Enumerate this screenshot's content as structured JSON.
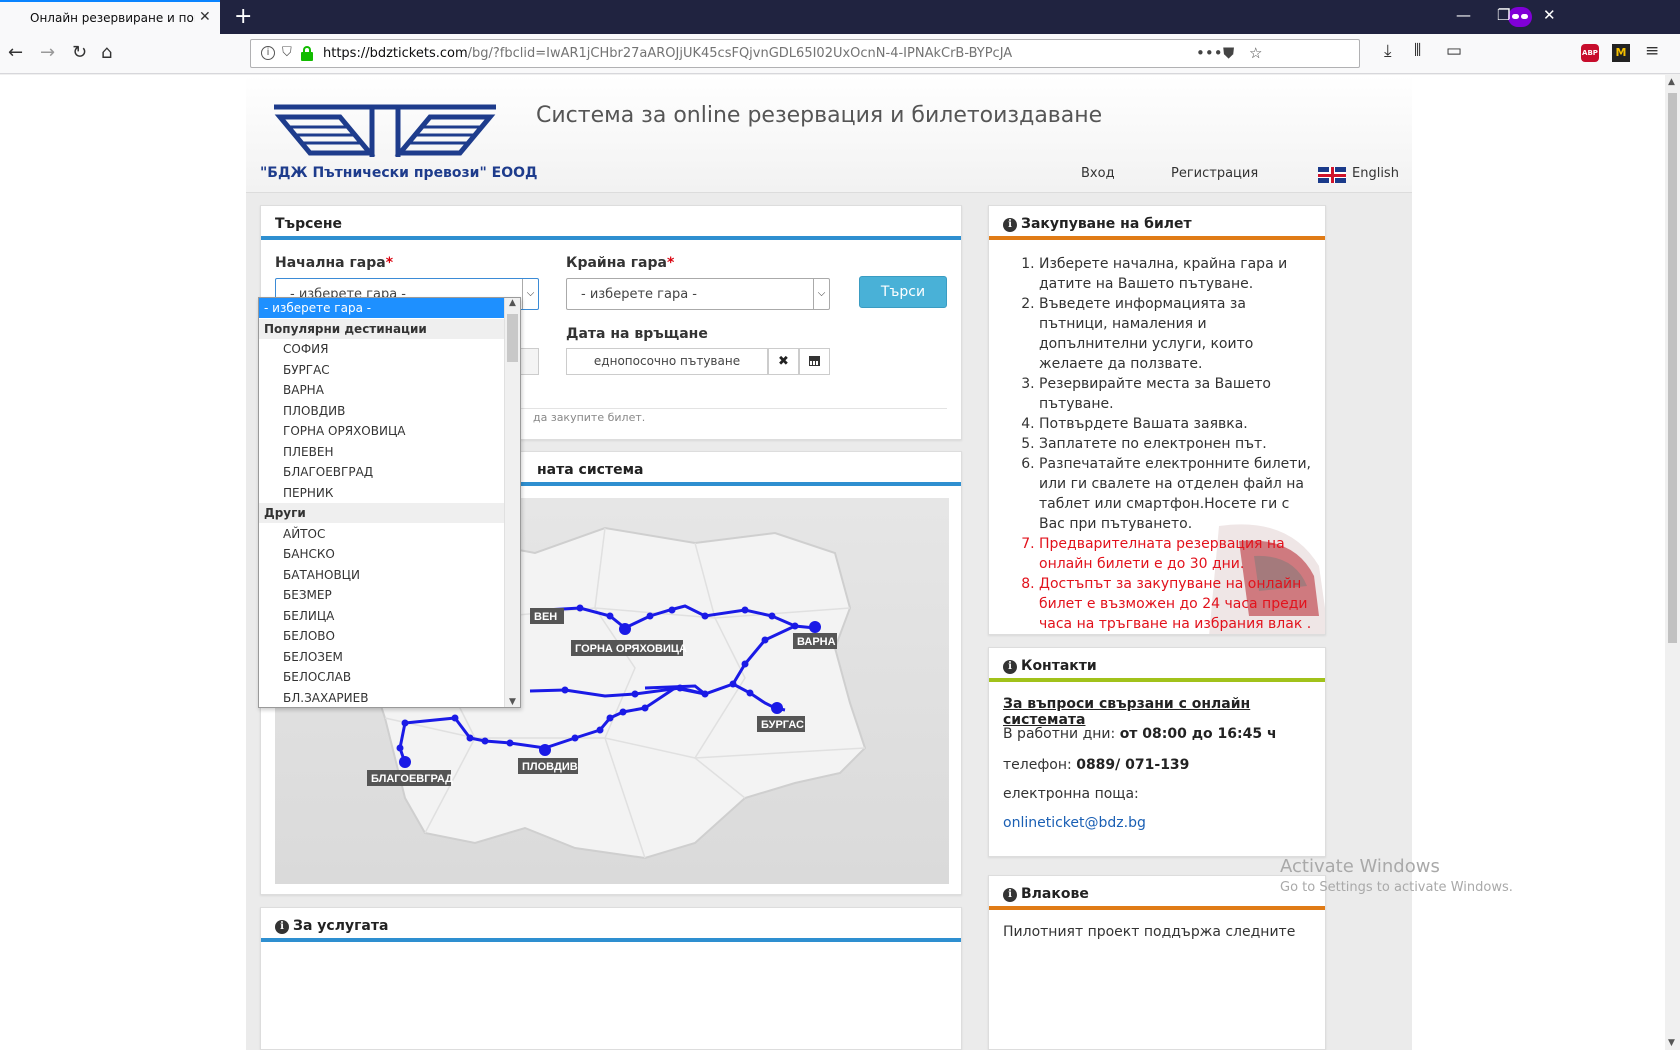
{
  "browser": {
    "tab_title": "Онлайн резервиране и покупка",
    "url_host": "https://bdztickets.com",
    "url_rest": "/bg/?fbclid=IwAR1jCHbr27aAROJjUK45csFQjvnGDL65I02UxOcnN-4-IPNAkCrB-BYPcJA"
  },
  "header": {
    "company": "\"БДЖ Пътнически превози\" ЕООД",
    "title": "Система за online резервация и билетоиздаване",
    "nav_login": "Вход",
    "nav_register": "Регистрация",
    "nav_english": "English"
  },
  "search": {
    "heading": "Търсене",
    "from_label": "Начална гара",
    "to_label": "Крайна гара",
    "required_mark": "*",
    "from_value": "- изберете гара -",
    "to_value": "- изберете гара -",
    "search_button": "Търси",
    "return_label": "Дата на връщане",
    "return_value": "еднопосочно пътуване",
    "hint_tail": "да закупите билет."
  },
  "dropdown": {
    "selected": "- изберете гара -",
    "groups": [
      {
        "label": "Популярни дестинации",
        "options": [
          "СОФИЯ",
          "БУРГАС",
          "ВАРНА",
          "ПЛОВДИВ",
          "ГОРНА ОРЯХОВИЦА",
          "ПЛЕВЕН",
          "БЛАГОЕВГРАД",
          "ПЕРНИК"
        ]
      },
      {
        "label": "Други",
        "options": [
          "АЙТОС",
          "БАНСКО",
          "БАТАНОВЦИ",
          "БЕЗМЕР",
          "БЕЛИЦА",
          "БЕЛОВО",
          "БЕЛОЗЕМ",
          "БЕЛОСЛАВ",
          "БЛ.ЗАХАРИЕВ"
        ]
      }
    ]
  },
  "map": {
    "heading_tail": "ната система",
    "city_labels": {
      "pleven": "ВЕН",
      "gorna": "ГОРНА ОРЯХОВИЦА",
      "varna": "ВАРНА",
      "burgas": "БУРГАС",
      "plovdiv": "ПЛОВДИВ",
      "blagoevgrad": "БЛАГОЕВГРАД"
    }
  },
  "service": {
    "heading": "За услугата"
  },
  "buy": {
    "heading": "Закупуване на билет",
    "steps": [
      {
        "text": "Изберете начална, крайна гара и датите на Вашето пътуване.",
        "red": false
      },
      {
        "text": "Въведете информацията за пътници, намаления и допълнителни услуги, които желаете да ползвате.",
        "red": false
      },
      {
        "text": "Резервирайте места за Вашето пътуване.",
        "red": false
      },
      {
        "text": "Потвърдете Вашата заявка.",
        "red": false
      },
      {
        "text": "Заплатете по електронен път.",
        "red": false
      },
      {
        "text": "Разпечатайте електронните билети, или ги свалете на отделен файл на таблет или смартфон.Носете ги с Вас при пътуването.",
        "red": false
      },
      {
        "text": "Предварителната резервация на онлайн билети е до 30 дни.",
        "red": true
      },
      {
        "text": "Достъпът за закупуване на онлайн билет е възможен до 24 часа преди часа на тръгване на избрания влак .",
        "red": true
      }
    ]
  },
  "contacts": {
    "heading": "Контакти",
    "subheading": "За въпроси свързани с онлайн системата",
    "workdays_label": "В работни дни:",
    "workdays_value": "от 08:00 до 16:45 ч",
    "phone_label": "телефон:",
    "phone_value": "0889/ 071-139",
    "email_label": "електронна поща:",
    "email_value": "onlineticket@bdz.bg"
  },
  "trains": {
    "heading": "Влакове",
    "text": "Пилотният проект поддържа следните"
  },
  "watermark": {
    "line1": "Activate Windows",
    "line2": "Go to Settings to activate Windows."
  },
  "colors": {
    "accent_blue": "#2e8fd0",
    "accent_orange": "#e07b16",
    "accent_green": "#a1c21a",
    "route_blue": "#1a1ae6"
  }
}
